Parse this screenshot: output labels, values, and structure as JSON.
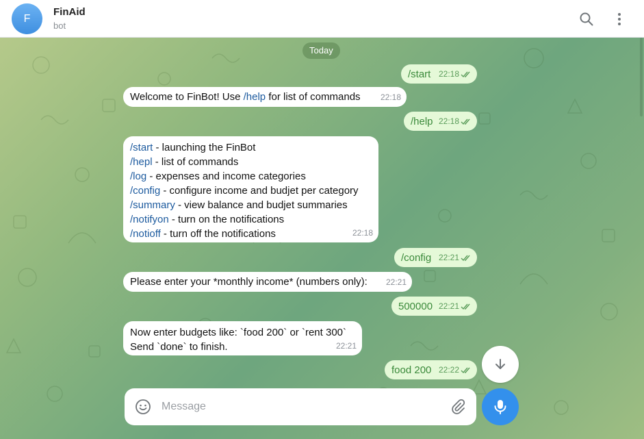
{
  "header": {
    "avatar_letter": "F",
    "name": "FinAid",
    "status": "bot"
  },
  "chat": {
    "date": "Today",
    "messages": [
      {
        "dir": "out",
        "text": "/start",
        "time": "22:18"
      },
      {
        "dir": "in",
        "prefix": "Welcome to FinBot! Use ",
        "cmd": "/help",
        "suffix": " for list of commands",
        "time": "22:18"
      },
      {
        "dir": "out",
        "text": "/help",
        "time": "22:18"
      },
      {
        "dir": "in",
        "lines": [
          {
            "cmd": "/start",
            "desc": " - launching the FinBot"
          },
          {
            "cmd": "/hepl",
            "desc": " - list of commands"
          },
          {
            "cmd": "/log",
            "desc": " - expenses and income categories"
          },
          {
            "cmd": "/config",
            "desc": " - configure income and budjet per category"
          },
          {
            "cmd": "/summary",
            "desc": " - view balance and budjet summaries"
          },
          {
            "cmd": "/notifyon",
            "desc": " - turn on the notifications"
          },
          {
            "cmd": "/notioff",
            "desc": " - turn off the notifications"
          }
        ],
        "time": "22:18"
      },
      {
        "dir": "out",
        "text": "/config",
        "time": "22:21"
      },
      {
        "dir": "in",
        "text": "Please enter your *monthly income* (numbers only):",
        "time": "22:21"
      },
      {
        "dir": "out",
        "text": "500000",
        "time": "22:21"
      },
      {
        "dir": "in",
        "lines_plain": [
          "Now enter budgets like: `food 200` or `rent 300`",
          "Send `done` to finish."
        ],
        "time": "22:21"
      },
      {
        "dir": "out",
        "text": "food 200",
        "time": "22:22"
      }
    ]
  },
  "composer": {
    "placeholder": "Message"
  },
  "icons": {
    "search": "search-icon",
    "menu": "more-vertical-icon",
    "emoji": "emoji-icon",
    "attach": "paperclip-icon",
    "mic": "microphone-icon",
    "scroll_down": "arrow-down-icon",
    "read": "double-check-icon"
  },
  "colors": {
    "accent": "#3390ec",
    "outgoing_bubble": "#e5f9d8",
    "incoming_bubble": "#ffffff",
    "command_link": "#1c5a9e"
  }
}
